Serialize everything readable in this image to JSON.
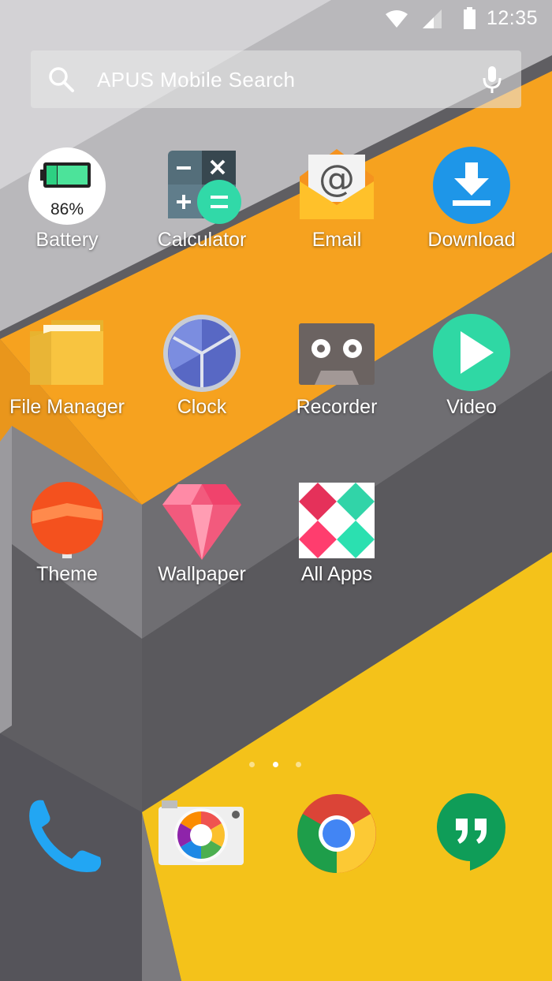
{
  "status_bar": {
    "time": "12:35",
    "icons": [
      "wifi-icon",
      "cell-signal-icon",
      "battery-icon"
    ]
  },
  "search": {
    "placeholder": "APUS Mobile Search",
    "icons": [
      "search-icon",
      "microphone-icon"
    ]
  },
  "apps": [
    {
      "label": "Battery",
      "icon": "battery-app-icon",
      "badge": "86%"
    },
    {
      "label": "Calculator",
      "icon": "calculator-icon"
    },
    {
      "label": "Email",
      "icon": "email-icon"
    },
    {
      "label": "Download",
      "icon": "download-icon"
    },
    {
      "label": "File Manager",
      "icon": "folder-icon"
    },
    {
      "label": "Clock",
      "icon": "clock-icon"
    },
    {
      "label": "Recorder",
      "icon": "cassette-icon"
    },
    {
      "label": "Video",
      "icon": "play-icon"
    },
    {
      "label": "Theme",
      "icon": "lollipop-icon"
    },
    {
      "label": "Wallpaper",
      "icon": "diamond-icon"
    },
    {
      "label": "All Apps",
      "icon": "all-apps-icon"
    }
  ],
  "page_indicator": {
    "pages": 3,
    "current": 2
  },
  "dock": [
    {
      "icon": "phone-icon"
    },
    {
      "icon": "camera-icon"
    },
    {
      "icon": "chrome-icon"
    },
    {
      "icon": "hangouts-icon"
    }
  ]
}
